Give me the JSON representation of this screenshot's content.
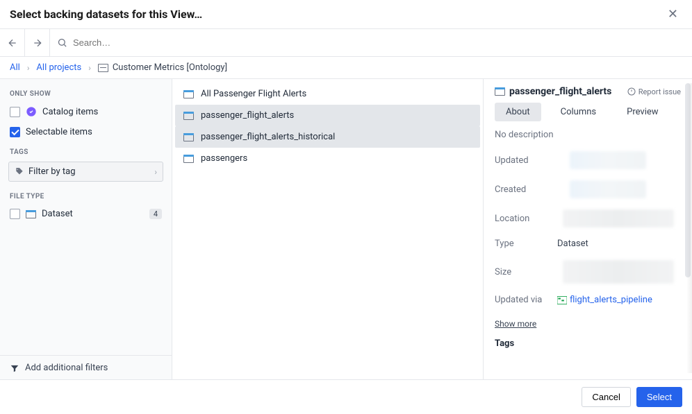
{
  "header": {
    "title": "Select backing datasets for this View…"
  },
  "search": {
    "placeholder": "Search…"
  },
  "breadcrumbs": {
    "root": "All",
    "project": "All projects",
    "leaf": "Customer Metrics [Ontology]"
  },
  "sidebar": {
    "onlyShowLabel": "ONLY SHOW",
    "catalogItems": {
      "label": "Catalog items",
      "checked": false
    },
    "selectableItems": {
      "label": "Selectable items",
      "checked": true
    },
    "tagsLabel": "TAGS",
    "filterByTag": "Filter by tag",
    "fileTypeLabel": "FILE TYPE",
    "datasetFilter": {
      "label": "Dataset",
      "count": "4",
      "checked": false
    },
    "addFilters": "Add additional filters"
  },
  "list": {
    "items": [
      {
        "name": "All Passenger Flight Alerts",
        "selected": false
      },
      {
        "name": "passenger_flight_alerts",
        "selected": true
      },
      {
        "name": "passenger_flight_alerts_historical",
        "selected": true
      },
      {
        "name": "passengers",
        "selected": false
      }
    ]
  },
  "details": {
    "title": "passenger_flight_alerts",
    "reportIssue": "Report issue",
    "tabs": {
      "about": "About",
      "columns": "Columns",
      "preview": "Preview"
    },
    "noDescription": "No description",
    "meta": {
      "updatedLabel": "Updated",
      "createdLabel": "Created",
      "locationLabel": "Location",
      "typeLabel": "Type",
      "typeValue": "Dataset",
      "sizeLabel": "Size",
      "updatedViaLabel": "Updated via",
      "updatedViaLink": "flight_alerts_pipeline"
    },
    "showMore": "Show more",
    "tagsHeader": "Tags"
  },
  "footer": {
    "cancel": "Cancel",
    "select": "Select"
  }
}
